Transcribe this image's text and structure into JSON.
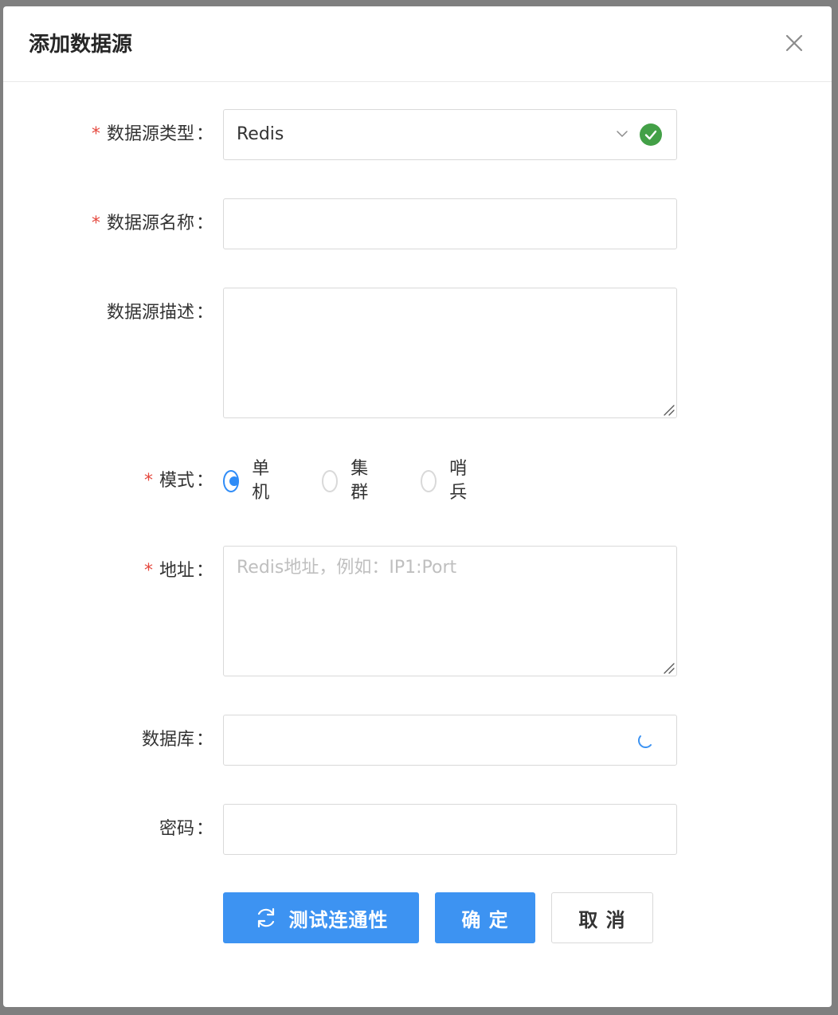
{
  "modal": {
    "title": "添加数据源"
  },
  "form": {
    "type": {
      "label": "数据源类型",
      "value": "Redis",
      "required": true
    },
    "name": {
      "label": "数据源名称",
      "value": "",
      "required": true
    },
    "description": {
      "label": "数据源描述",
      "value": "",
      "required": false
    },
    "mode": {
      "label": "模式",
      "required": true,
      "options": [
        "单机",
        "集群",
        "哨兵"
      ],
      "selected": "单机"
    },
    "address": {
      "label": "地址",
      "placeholder": "Redis地址，例如：IP1:Port",
      "required": true
    },
    "database": {
      "label": "数据库",
      "value": ""
    },
    "password": {
      "label": "密码",
      "value": ""
    },
    "colon": "："
  },
  "buttons": {
    "test": "测试连通性",
    "confirm": "确 定",
    "cancel": "取 消"
  },
  "colors": {
    "primary": "#3d93f2",
    "required": "#e5483e",
    "success": "#43a047"
  },
  "icons": {
    "close": "close-icon",
    "chevron": "chevron-down-icon",
    "valid": "check-circle-icon",
    "loading": "loading-spinner-icon",
    "refresh": "refresh-icon"
  }
}
